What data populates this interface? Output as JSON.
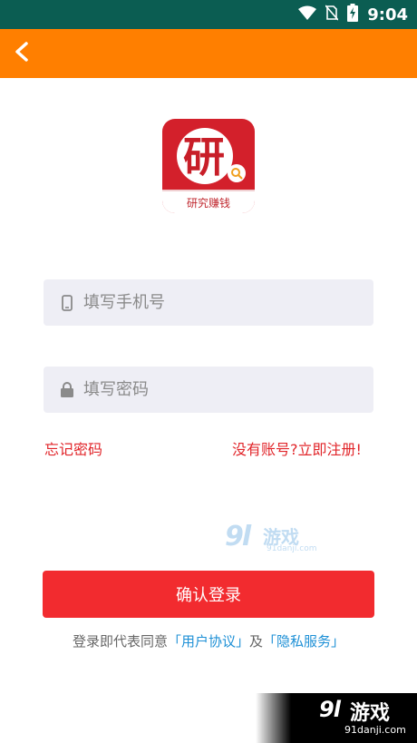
{
  "status_bar": {
    "time": "9:04",
    "icons": [
      "wifi-icon",
      "no-sim-icon",
      "battery-charging-icon"
    ]
  },
  "app_bar": {
    "back_icon": "back-arrow-icon",
    "background": "#ff7f00"
  },
  "logo": {
    "glyph": "研",
    "caption": "研究赚钱"
  },
  "form": {
    "phone_placeholder": "填写手机号",
    "phone_value": "",
    "password_placeholder": "填写密码",
    "password_value": ""
  },
  "links": {
    "forgot_password": "忘记密码",
    "register": "没有账号?立即注册!"
  },
  "watermark": {
    "logo": "9l",
    "name": "游戏",
    "site": "91danji.com"
  },
  "login_button": "确认登录",
  "agreement": {
    "prefix": "登录即代表同意",
    "user_agreement": "「用户协议」",
    "conjunction": "及",
    "privacy": "「隐私服务」"
  },
  "corner_watermark": {
    "logo": "9l",
    "name": "游戏",
    "site": "91danji.com"
  },
  "colors": {
    "status_bar": "#0b5d52",
    "accent_red": "#f22b2f",
    "link_blue": "#1e90d6"
  }
}
